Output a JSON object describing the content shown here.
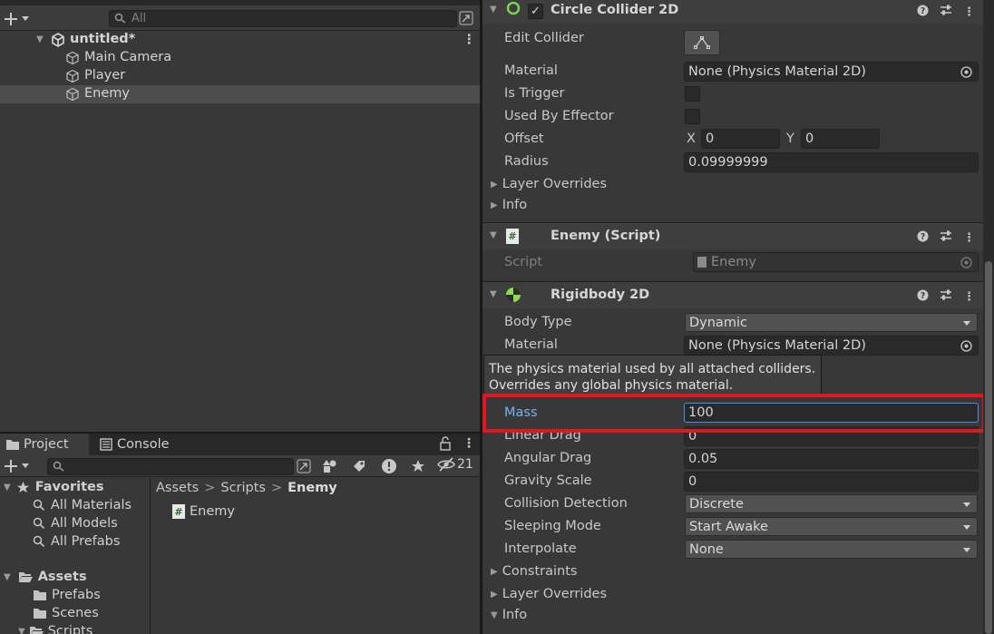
{
  "hierarchy": {
    "search_placeholder": "All",
    "scene_name": "untitled*",
    "items": [
      {
        "label": "Main Camera"
      },
      {
        "label": "Player"
      },
      {
        "label": "Enemy"
      }
    ]
  },
  "project": {
    "tabs": [
      {
        "label": "Project"
      },
      {
        "label": "Console"
      }
    ],
    "hidden_count": "21",
    "favorites": {
      "title": "Favorites",
      "items": [
        {
          "label": "All Materials"
        },
        {
          "label": "All Models"
        },
        {
          "label": "All Prefabs"
        }
      ]
    },
    "assets": {
      "title": "Assets",
      "items": [
        {
          "label": "Prefabs"
        },
        {
          "label": "Scenes"
        },
        {
          "label": "Scripts"
        }
      ]
    },
    "breadcrumb": {
      "root": "Assets",
      "mid": "Scripts",
      "current": "Enemy",
      "sep": ">"
    },
    "files": [
      {
        "label": "Enemy"
      }
    ]
  },
  "inspector": {
    "circle_collider": {
      "title": "Circle Collider 2D",
      "edit_collider": "Edit Collider",
      "material_label": "Material",
      "material_value": "None (Physics Material 2D)",
      "is_trigger": "Is Trigger",
      "used_by_effector": "Used By Effector",
      "offset_label": "Offset",
      "offset_x_label": "X",
      "offset_x": "0",
      "offset_y_label": "Y",
      "offset_y": "0",
      "radius_label": "Radius",
      "radius_value": "0.09999999",
      "layer_overrides": "Layer Overrides",
      "info": "Info"
    },
    "enemy_script": {
      "title": "Enemy (Script)",
      "script_label": "Script",
      "script_value": "Enemy"
    },
    "rigidbody": {
      "title": "Rigidbody 2D",
      "body_type_label": "Body Type",
      "body_type_value": "Dynamic",
      "material_label": "Material",
      "material_value": "None (Physics Material 2D)",
      "tooltip": "The physics material used by all attached colliders. Overrides any global physics material.",
      "mass_label": "Mass",
      "mass_value": "100",
      "linear_drag_label": "Linear Drag",
      "linear_drag_value": "0",
      "angular_drag_label": "Angular Drag",
      "angular_drag_value": "0.05",
      "gravity_scale_label": "Gravity Scale",
      "gravity_scale_value": "0",
      "collision_detection_label": "Collision Detection",
      "collision_detection_value": "Discrete",
      "sleeping_mode_label": "Sleeping Mode",
      "sleeping_mode_value": "Start Awake",
      "interpolate_label": "Interpolate",
      "interpolate_value": "None",
      "constraints": "Constraints",
      "layer_overrides": "Layer Overrides",
      "info": "Info"
    }
  },
  "colors": {
    "highlight": "#e0171f",
    "accent_label": "#7cb2f4",
    "panel_bg": "#383838"
  }
}
